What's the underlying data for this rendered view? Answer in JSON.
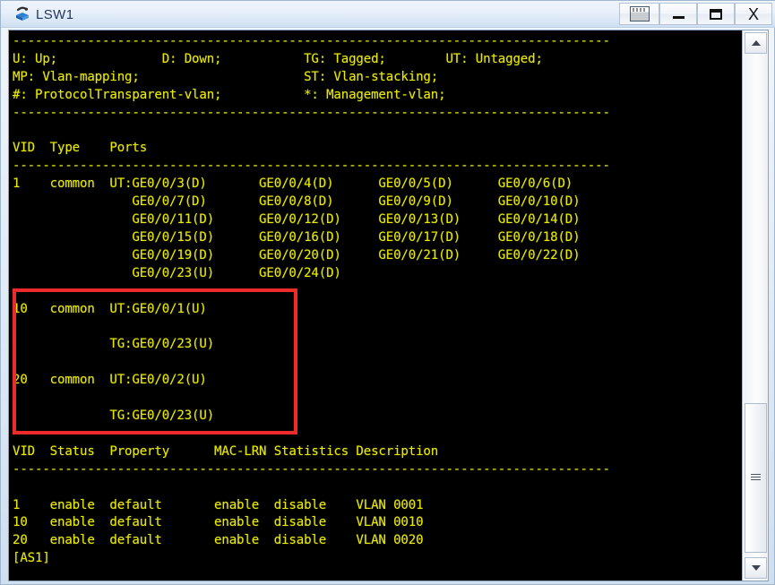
{
  "window": {
    "title": "LSW1",
    "icon": "switch-icon",
    "controls": [
      {
        "name": "restore-desktop-button",
        "glyph": "desktop-icon",
        "label": ""
      },
      {
        "name": "minimize-button",
        "glyph": "minimize-icon",
        "label": ""
      },
      {
        "name": "maximize-button",
        "glyph": "maximize-icon",
        "label": ""
      },
      {
        "name": "close-button",
        "glyph": "close-icon",
        "label": "X"
      }
    ]
  },
  "colors": {
    "terminal_background": "#000000",
    "terminal_text": "#e8e800",
    "highlight_box": "#ee2b2b",
    "titlebar_text": "#23395b"
  },
  "terminal": {
    "legend": {
      "rule_top": "--------------------------------------------------------------------------------",
      "line1": "U: Up;              D: Down;           TG: Tagged;        UT: Untagged;",
      "line2": "MP: Vlan-mapping;                      ST: Vlan-stacking;",
      "line3": "#: ProtocolTransparent-vlan;           *: Management-vlan;",
      "rule_bottom": "--------------------------------------------------------------------------------"
    },
    "ports_table": {
      "header": "VID  Type    Ports",
      "rule": "--------------------------------------------------------------------------------",
      "rows": [
        "1    common  UT:GE0/0/3(D)       GE0/0/4(D)      GE0/0/5(D)      GE0/0/6(D)",
        "                GE0/0/7(D)       GE0/0/8(D)      GE0/0/9(D)      GE0/0/10(D)",
        "                GE0/0/11(D)      GE0/0/12(D)     GE0/0/13(D)     GE0/0/14(D)",
        "                GE0/0/15(D)      GE0/0/16(D)     GE0/0/17(D)     GE0/0/18(D)",
        "                GE0/0/19(D)      GE0/0/20(D)     GE0/0/21(D)     GE0/0/22(D)",
        "                GE0/0/23(U)      GE0/0/24(D)",
        "",
        "10   common  UT:GE0/0/1(U)",
        "",
        "             TG:GE0/0/23(U)",
        "",
        "20   common  UT:GE0/0/2(U)",
        "",
        "             TG:GE0/0/23(U)",
        ""
      ]
    },
    "status_table": {
      "header": "VID  Status  Property      MAC-LRN Statistics Description",
      "rule": "--------------------------------------------------------------------------------",
      "rows": [
        "1    enable  default       enable  disable    VLAN 0001",
        "10   enable  default       enable  disable    VLAN 0010",
        "20   enable  default       enable  disable    VLAN 0020"
      ]
    },
    "prompt": "[AS1]"
  },
  "scrollbar": {
    "up_arrow": "scroll-up-arrow",
    "down_arrow": "scroll-down-arrow",
    "thumb": "scroll-thumb"
  },
  "highlight": {
    "description": "red annotation box around VLAN 10 and VLAN 20 port rows"
  }
}
